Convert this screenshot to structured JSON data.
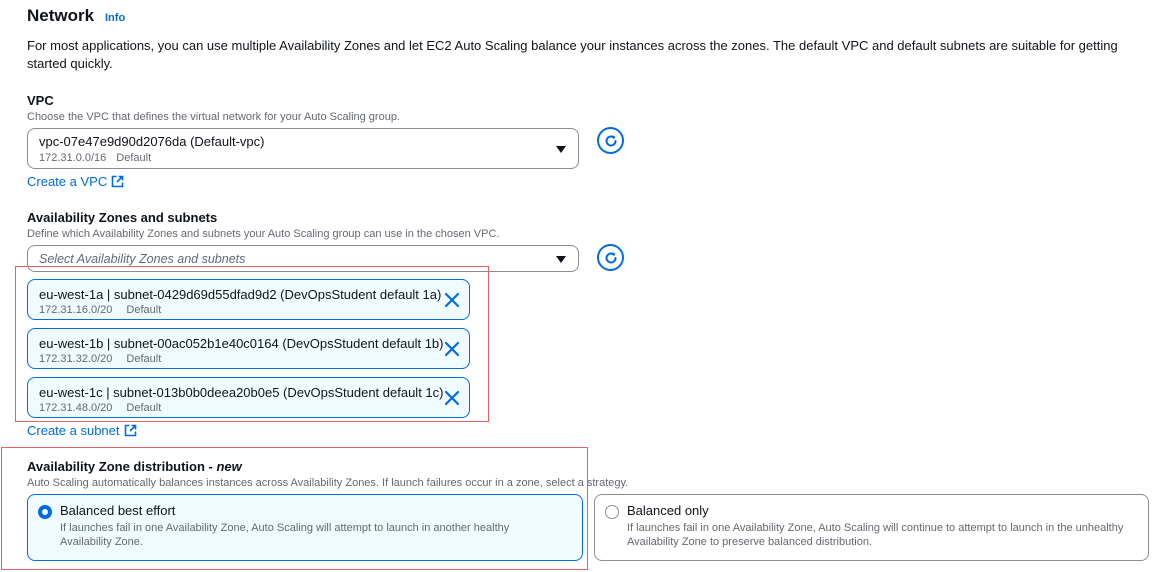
{
  "section": {
    "title": "Network",
    "info": "Info",
    "description": "For most applications, you can use multiple Availability Zones and let EC2 Auto Scaling balance your instances across the zones. The default VPC and default subnets are suitable for getting started quickly."
  },
  "vpc": {
    "label": "VPC",
    "description": "Choose the VPC that defines the virtual network for your Auto Scaling group.",
    "selected_name": "vpc-07e47e9d90d2076da (Default-vpc)",
    "selected_cidr": "172.31.0.0/16",
    "selected_tag": "Default",
    "create_link": "Create a VPC"
  },
  "subnets": {
    "label": "Availability Zones and subnets",
    "description": "Define which Availability Zones and subnets your Auto Scaling group can use in the chosen VPC.",
    "placeholder": "Select Availability Zones and subnets",
    "tokens": [
      {
        "name": "eu-west-1a | subnet-0429d69d55dfad9d2 (DevOpsStudent default 1a)",
        "cidr": "172.31.16.0/20",
        "tag": "Default"
      },
      {
        "name": "eu-west-1b | subnet-00ac052b1e40c0164 (DevOpsStudent default 1b)",
        "cidr": "172.31.32.0/20",
        "tag": "Default"
      },
      {
        "name": "eu-west-1c | subnet-013b0b0deea20b0e5 (DevOpsStudent default 1c)",
        "cidr": "172.31.48.0/20",
        "tag": "Default"
      }
    ],
    "create_link": "Create a subnet"
  },
  "distribution": {
    "label": "Availability Zone distribution - ",
    "label_new": "new",
    "description": "Auto Scaling automatically balances instances across Availability Zones. If launch failures occur in a zone, select a strategy.",
    "options": [
      {
        "title": "Balanced best effort",
        "description": "If launches fail in one Availability Zone, Auto Scaling will attempt to launch in another healthy Availability Zone.",
        "selected": true
      },
      {
        "title": "Balanced only",
        "description": "If launches fail in one Availability Zone, Auto Scaling will continue to attempt to launch in the unhealthy Availability Zone to preserve balanced distribution.",
        "selected": false
      }
    ]
  },
  "colors": {
    "accent": "#006ce0",
    "selected_bg": "#f0fbff",
    "highlight_border": "#e06464"
  },
  "icons": {
    "refresh": "refresh-icon",
    "external": "external-link-icon",
    "remove": "close-icon",
    "dropdown": "caret-down-icon"
  }
}
